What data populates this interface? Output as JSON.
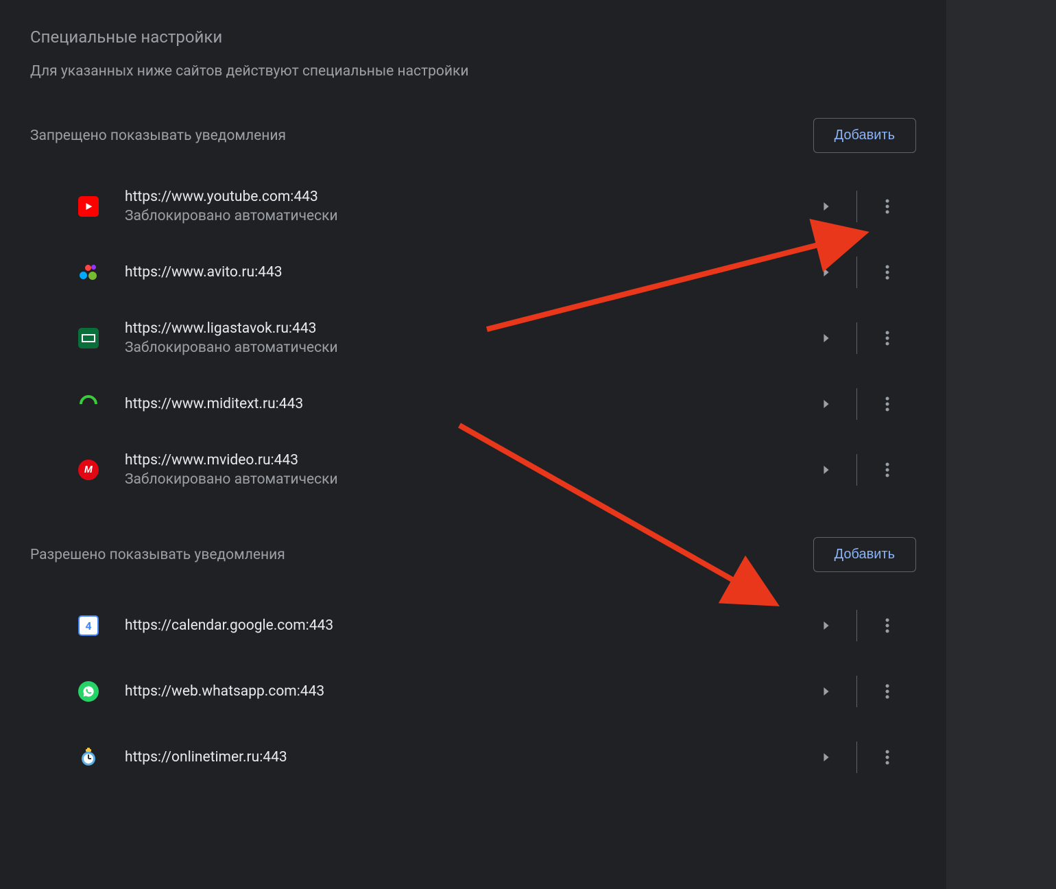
{
  "header": {
    "title": "Специальные настройки",
    "subtitle": "Для указанных ниже сайтов действуют специальные настройки"
  },
  "blocked": {
    "title": "Запрещено показывать уведомления",
    "add_label": "Добавить",
    "sites": [
      {
        "url": "https://www.youtube.com:443",
        "status": "Заблокировано автоматически",
        "icon": "youtube"
      },
      {
        "url": "https://www.avito.ru:443",
        "status": "",
        "icon": "avito"
      },
      {
        "url": "https://www.ligastavok.ru:443",
        "status": "Заблокировано автоматически",
        "icon": "ligastavok"
      },
      {
        "url": "https://www.miditext.ru:443",
        "status": "",
        "icon": "miditext"
      },
      {
        "url": "https://www.mvideo.ru:443",
        "status": "Заблокировано автоматически",
        "icon": "mvideo"
      }
    ]
  },
  "allowed": {
    "title": "Разрешено показывать уведомления",
    "add_label": "Добавить",
    "sites": [
      {
        "url": "https://calendar.google.com:443",
        "status": "",
        "icon": "gcal"
      },
      {
        "url": "https://web.whatsapp.com:443",
        "status": "",
        "icon": "whatsapp"
      },
      {
        "url": "https://onlinetimer.ru:443",
        "status": "",
        "icon": "timer"
      }
    ]
  }
}
